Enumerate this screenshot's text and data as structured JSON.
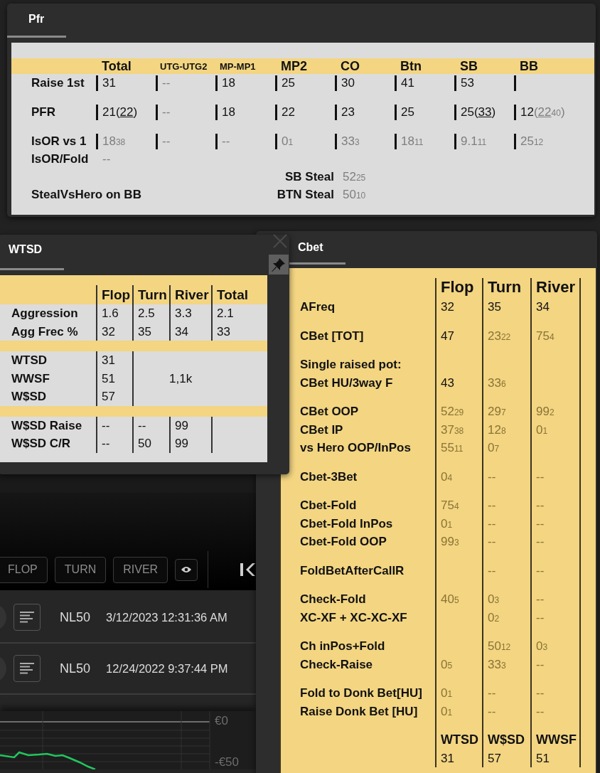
{
  "pfr": {
    "tab": {
      "label": "Pfr",
      "selected": true
    },
    "columns": [
      {
        "label": "Total",
        "small": false
      },
      {
        "label": "UTG-UTG2",
        "small": true
      },
      {
        "label": "MP-MP1",
        "small": true
      },
      {
        "label": "MP2",
        "small": false
      },
      {
        "label": "CO",
        "small": false
      },
      {
        "label": "Btn",
        "small": false
      },
      {
        "label": "SB",
        "small": false
      },
      {
        "label": "BB",
        "small": false
      }
    ],
    "rows": [
      {
        "label": "Raise 1st",
        "bars": true,
        "cells": [
          {
            "value": "31"
          },
          {
            "value": "--",
            "dim": true
          },
          {
            "value": "18"
          },
          {
            "value": "25"
          },
          {
            "value": "30"
          },
          {
            "value": "41"
          },
          {
            "value": "53"
          },
          null
        ]
      },
      {
        "label": "PFR",
        "bars": true,
        "cells": [
          {
            "parts": [
              {
                "text": "21"
              },
              {
                "text": "("
              },
              {
                "text": "22",
                "underline": true
              },
              {
                "text": ")"
              }
            ]
          },
          {
            "value": "--",
            "dim": true
          },
          {
            "value": "18"
          },
          {
            "value": "22"
          },
          {
            "value": "23"
          },
          {
            "value": "25"
          },
          {
            "parts": [
              {
                "text": "25"
              },
              {
                "text": "("
              },
              {
                "text": "33",
                "underline": true
              },
              {
                "text": ")"
              }
            ]
          },
          {
            "parts": [
              {
                "text": "12"
              },
              {
                "text": "(",
                "dim": true
              },
              {
                "text": "22",
                "dim": true,
                "underline": true
              },
              {
                "text": "40",
                "dim": true,
                "small": true
              },
              {
                "text": ")",
                "dim": true
              }
            ]
          }
        ]
      },
      {
        "label": "IsOR vs 1",
        "bars": true,
        "cells": [
          {
            "value": "18",
            "count": "38",
            "dim": true
          },
          {
            "value": "--",
            "dim": true
          },
          {
            "value": "--",
            "dim": true
          },
          {
            "value": "0",
            "count": "1",
            "dim": true
          },
          {
            "value": "33",
            "count": "3",
            "dim": true
          },
          {
            "value": "18",
            "count": "11",
            "dim": true
          },
          {
            "value": "9.1",
            "count": "11",
            "dim": true
          },
          {
            "value": "25",
            "count": "12",
            "dim": true
          }
        ]
      },
      {
        "label": "IsOR/Fold",
        "bars": false,
        "cells": [
          {
            "value": "--",
            "dim": true
          }
        ]
      }
    ],
    "steals": [
      {
        "label": "SB Steal",
        "cell": {
          "value": "52",
          "count": "25",
          "dim": true
        }
      },
      {
        "label": "BTN Steal",
        "cell": {
          "value": "50",
          "count": "10",
          "dim": true
        }
      }
    ],
    "steal_vs_hero_label": "StealVsHero on BB"
  },
  "wtsd": {
    "tab": {
      "label": "WTSD",
      "selected": true
    },
    "columns": [
      "Flop",
      "Turn",
      "River",
      "Total"
    ],
    "sections": [
      {
        "rows": [
          {
            "label": "Aggression",
            "cells": [
              {
                "value": "1.6"
              },
              {
                "value": "2.5"
              },
              {
                "value": "3.3"
              },
              {
                "value": "2.1"
              }
            ]
          },
          {
            "label": "Agg Frec %",
            "cells": [
              {
                "value": "32"
              },
              {
                "value": "35"
              },
              {
                "value": "34"
              },
              {
                "value": "33"
              }
            ]
          }
        ]
      },
      {
        "rows": [
          {
            "label": "WTSD",
            "cells": [
              {
                "value": "31"
              }
            ]
          },
          {
            "label": "WWSF",
            "cells": [
              {
                "value": "51"
              }
            ]
          },
          {
            "label": "W$SD",
            "cells": [
              {
                "value": "57"
              }
            ]
          }
        ],
        "merged": {
          "value": "1,1k"
        }
      },
      {
        "rows": [
          {
            "label": "W$SD Raise",
            "cells": [
              {
                "value": "--"
              },
              {
                "value": "--"
              },
              {
                "value": "99"
              },
              null
            ]
          },
          {
            "label": "W$SD C/R",
            "cells": [
              {
                "value": "--"
              },
              {
                "value": "50"
              },
              {
                "value": "99"
              },
              null
            ]
          }
        ]
      }
    ]
  },
  "cbet": {
    "tab": {
      "label": "Cbet",
      "selected": true
    },
    "columns": [
      "Flop",
      "Turn",
      "River"
    ],
    "groups": [
      [
        {
          "label": "AFreq",
          "cells": [
            {
              "value": "32"
            },
            {
              "value": "35"
            },
            {
              "value": "34"
            }
          ]
        }
      ],
      [
        {
          "label": "CBet [TOT]",
          "cells": [
            {
              "value": "47"
            },
            {
              "value": "23",
              "count": "22",
              "dim": true
            },
            {
              "value": "75",
              "count": "4",
              "dim": true
            }
          ]
        }
      ],
      [
        {
          "label": "Single raised pot:",
          "cells": [
            null,
            null,
            null
          ]
        },
        {
          "label": "CBet HU/3way F",
          "cells": [
            {
              "value": "43"
            },
            {
              "value": "33",
              "count": "6",
              "dim": true
            },
            null
          ]
        }
      ],
      [
        {
          "label": "CBet OOP",
          "cells": [
            {
              "value": "52",
              "count": "29",
              "dim": true
            },
            {
              "value": "29",
              "count": "7",
              "dim": true
            },
            {
              "value": "99",
              "count": "2",
              "dim": true
            }
          ]
        },
        {
          "label": "CBet IP",
          "cells": [
            {
              "value": "37",
              "count": "38",
              "dim": true
            },
            {
              "value": "12",
              "count": "8",
              "dim": true
            },
            {
              "value": "0",
              "count": "1",
              "dim": true
            }
          ]
        },
        {
          "label": "vs Hero OOP/InPos",
          "cells": [
            {
              "value": "55",
              "count": "11",
              "dim": true
            },
            {
              "value": "0",
              "count": "7",
              "dim": true
            },
            null
          ]
        }
      ],
      [
        {
          "label": "Cbet-3Bet",
          "cells": [
            {
              "value": "0",
              "count": "4",
              "dim": true
            },
            {
              "value": "--",
              "dim": true
            },
            {
              "value": "--",
              "dim": true
            }
          ]
        }
      ],
      [
        {
          "label": "Cbet-Fold",
          "cells": [
            {
              "value": "75",
              "count": "4",
              "dim": true
            },
            {
              "value": "--",
              "dim": true
            },
            {
              "value": "--",
              "dim": true
            }
          ]
        },
        {
          "label": "Cbet-Fold InPos",
          "cells": [
            {
              "value": "0",
              "count": "1",
              "dim": true
            },
            {
              "value": "--",
              "dim": true
            },
            {
              "value": "--",
              "dim": true
            }
          ]
        },
        {
          "label": "Cbet-Fold OOP",
          "cells": [
            {
              "value": "99",
              "count": "3",
              "dim": true
            },
            {
              "value": "--",
              "dim": true
            },
            {
              "value": "--",
              "dim": true
            }
          ]
        }
      ],
      [
        {
          "label": "FoldBetAfterCallR",
          "cells": [
            null,
            {
              "value": "--",
              "dim": true
            },
            {
              "value": "--",
              "dim": true
            }
          ]
        }
      ],
      [
        {
          "label": "Check-Fold",
          "cells": [
            {
              "value": "40",
              "count": "5",
              "dim": true
            },
            {
              "value": "0",
              "count": "3",
              "dim": true
            },
            {
              "value": "--",
              "dim": true
            }
          ]
        },
        {
          "label": "XC-XF + XC-XC-XF",
          "cells": [
            null,
            {
              "value": "0",
              "count": "2",
              "dim": true
            },
            {
              "value": "--",
              "dim": true
            }
          ]
        }
      ],
      [
        {
          "label": "Ch inPos+Fold",
          "cells": [
            null,
            {
              "value": "50",
              "count": "12",
              "dim": true
            },
            {
              "value": "0",
              "count": "3",
              "dim": true
            }
          ]
        },
        {
          "label": "Check-Raise",
          "cells": [
            {
              "value": "0",
              "count": "5",
              "dim": true
            },
            {
              "value": "33",
              "count": "3",
              "dim": true
            },
            {
              "value": "--",
              "dim": true
            }
          ]
        }
      ],
      [
        {
          "label": "Fold to Donk Bet[HU]",
          "cells": [
            {
              "value": "0",
              "count": "1",
              "dim": true
            },
            {
              "value": "--",
              "dim": true
            },
            {
              "value": "--",
              "dim": true
            }
          ]
        },
        {
          "label": "Raise Donk Bet [HU]",
          "cells": [
            {
              "value": "0",
              "count": "1",
              "dim": true
            },
            {
              "value": "--",
              "dim": true
            },
            {
              "value": "--",
              "dim": true
            }
          ]
        }
      ]
    ],
    "footer": [
      {
        "label": "WTSD",
        "value": "31"
      },
      {
        "label": "W$SD",
        "value": "57"
      },
      {
        "label": "WWSF",
        "value": "51"
      }
    ]
  },
  "replayer": {
    "street_buttons": [
      "FLOP",
      "TURN",
      "RIVER"
    ],
    "hands": [
      {
        "stake": "NL50",
        "time": "3/12/2023 12:31:36 AM"
      },
      {
        "stake": "NL50",
        "time": "12/24/2022 9:37:44 PM"
      }
    ],
    "graph": {
      "y_labels": [
        "€0",
        "-€50"
      ]
    }
  }
}
